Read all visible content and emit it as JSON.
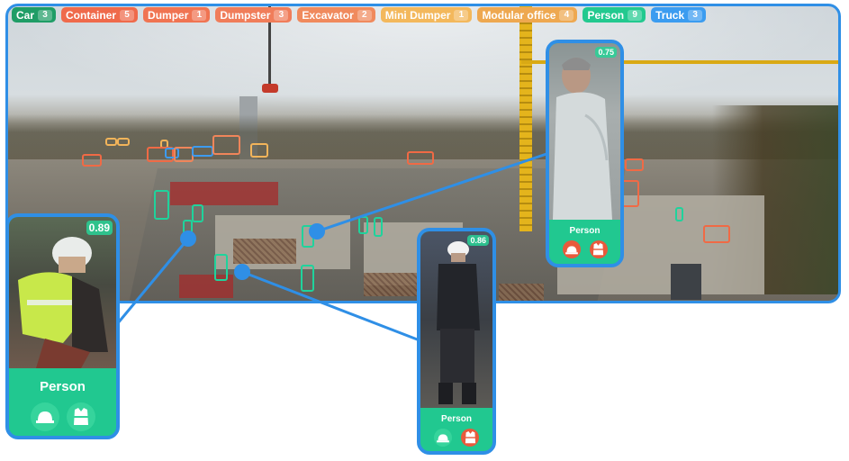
{
  "chips": [
    {
      "label": "Car",
      "count": "3",
      "color": "#1f9d66"
    },
    {
      "label": "Container",
      "count": "5",
      "color": "#ef6a4b"
    },
    {
      "label": "Dumper",
      "count": "1",
      "color": "#f07452"
    },
    {
      "label": "Dumpster",
      "count": "3",
      "color": "#f07d5a"
    },
    {
      "label": "Excavator",
      "count": "2",
      "color": "#f08a5d"
    },
    {
      "label": "Mini Dumper",
      "count": "1",
      "color": "#f3b85c"
    },
    {
      "label": "Modular office",
      "count": "4",
      "color": "#eea850"
    },
    {
      "label": "Person",
      "count": "9",
      "color": "#22c98f"
    },
    {
      "label": "Truck",
      "count": "3",
      "color": "#3b9cf0"
    }
  ],
  "cards": [
    {
      "id": "left",
      "score": "0.89",
      "label": "Person",
      "helmet": "ok",
      "vest": "ok"
    },
    {
      "id": "middle",
      "score": "0.86",
      "label": "Person",
      "helmet": "ok",
      "vest": "bad"
    },
    {
      "id": "right",
      "score": "0.75",
      "label": "Person",
      "helmet": "bad",
      "vest": "bad"
    }
  ],
  "colors": {
    "frame": "#2f8fe6",
    "person": "#1fd39c",
    "container": "#f06a45",
    "truck": "#3d9bef",
    "ppe_ok": "#36d49c",
    "ppe_missing": "#e85a3c"
  }
}
